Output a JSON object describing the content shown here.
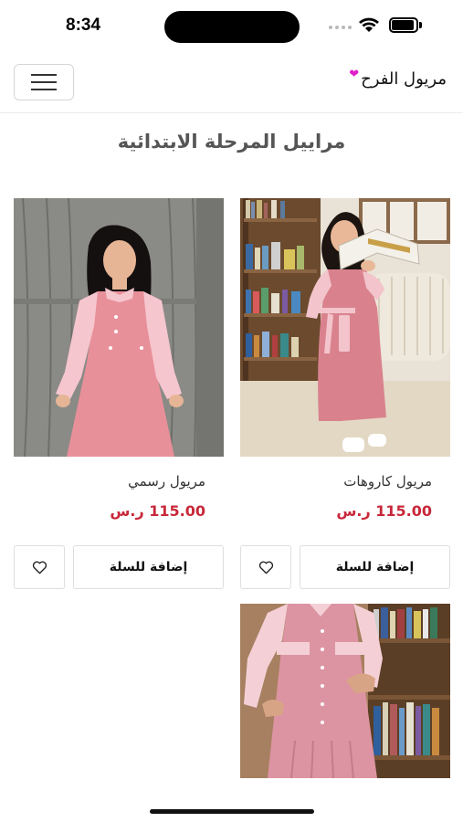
{
  "status_bar": {
    "time": "8:34"
  },
  "header": {
    "brand": "مريول الفرح",
    "menu_icon": "hamburger-menu-icon",
    "logo_icon": "heart-icon",
    "logo_color": "#e020c8"
  },
  "page": {
    "title": "مراييل المرحلة الابتدائية"
  },
  "products": [
    {
      "name": "مريول كاروهات",
      "price": "115.00 ر.س",
      "add_to_cart": "إضافة للسلة",
      "wishlist_icon": "heart-outline-icon"
    },
    {
      "name": "مريول رسمي",
      "price": "115.00 ر.س",
      "add_to_cart": "إضافة للسلة",
      "wishlist_icon": "heart-outline-icon"
    },
    {
      "name": "",
      "price": "",
      "add_to_cart": "",
      "wishlist_icon": ""
    }
  ],
  "colors": {
    "price": "#c8283a",
    "dress_pink": "#e8909a"
  }
}
